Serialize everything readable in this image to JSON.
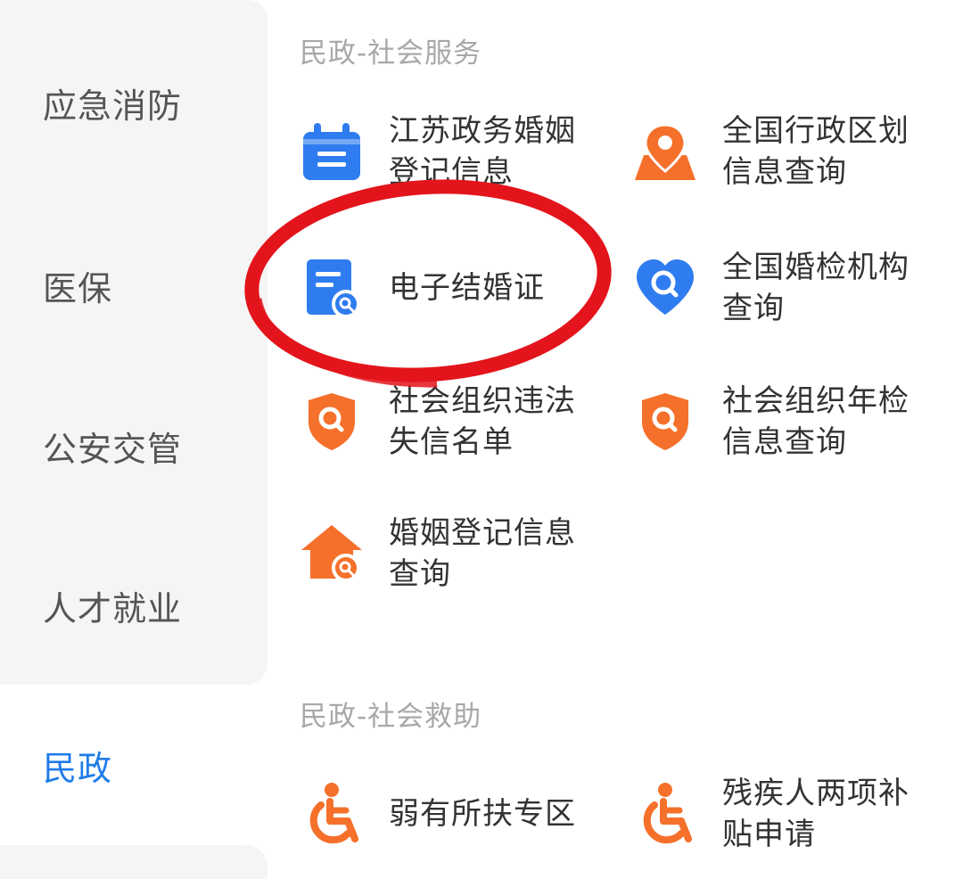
{
  "sidebar": {
    "items": [
      {
        "label": "应急消防"
      },
      {
        "label": "医保"
      },
      {
        "label": "公安交管"
      },
      {
        "label": "人才就业"
      },
      {
        "label": "民政",
        "active": true
      }
    ]
  },
  "sections": [
    {
      "title": "民政-社会服务",
      "tiles": [
        {
          "label": "江苏政务婚姻\n登记信息",
          "icon": "calendar-icon",
          "color": "#2f7cf0"
        },
        {
          "label": "全国行政区划\n信息查询",
          "icon": "map-pin-icon",
          "color": "#f5702a"
        },
        {
          "label": "电子结婚证",
          "icon": "document-search-icon",
          "color": "#2f7cf0"
        },
        {
          "label": "全国婚检机构\n查询",
          "icon": "heart-search-icon",
          "color": "#2f7cf0"
        },
        {
          "label": "社会组织违法\n失信名单",
          "icon": "shield-search-icon",
          "color": "#f5702a"
        },
        {
          "label": "社会组织年检\n信息查询",
          "icon": "shield-search-icon",
          "color": "#f5702a"
        },
        {
          "label": "婚姻登记信息\n查询",
          "icon": "house-search-icon",
          "color": "#f5702a"
        }
      ]
    },
    {
      "title": "民政-社会救助",
      "tiles": [
        {
          "label": "弱有所扶专区",
          "icon": "wheelchair-icon",
          "color": "#f5702a"
        },
        {
          "label": "残疾人两项补\n贴申请",
          "icon": "wheelchair-icon",
          "color": "#f5702a"
        }
      ]
    }
  ],
  "colors": {
    "accent_blue": "#2f7cf0",
    "accent_orange": "#f5702a",
    "active_sidebar_text": "#1f7ce8",
    "highlight_ring": "#e3141b"
  }
}
